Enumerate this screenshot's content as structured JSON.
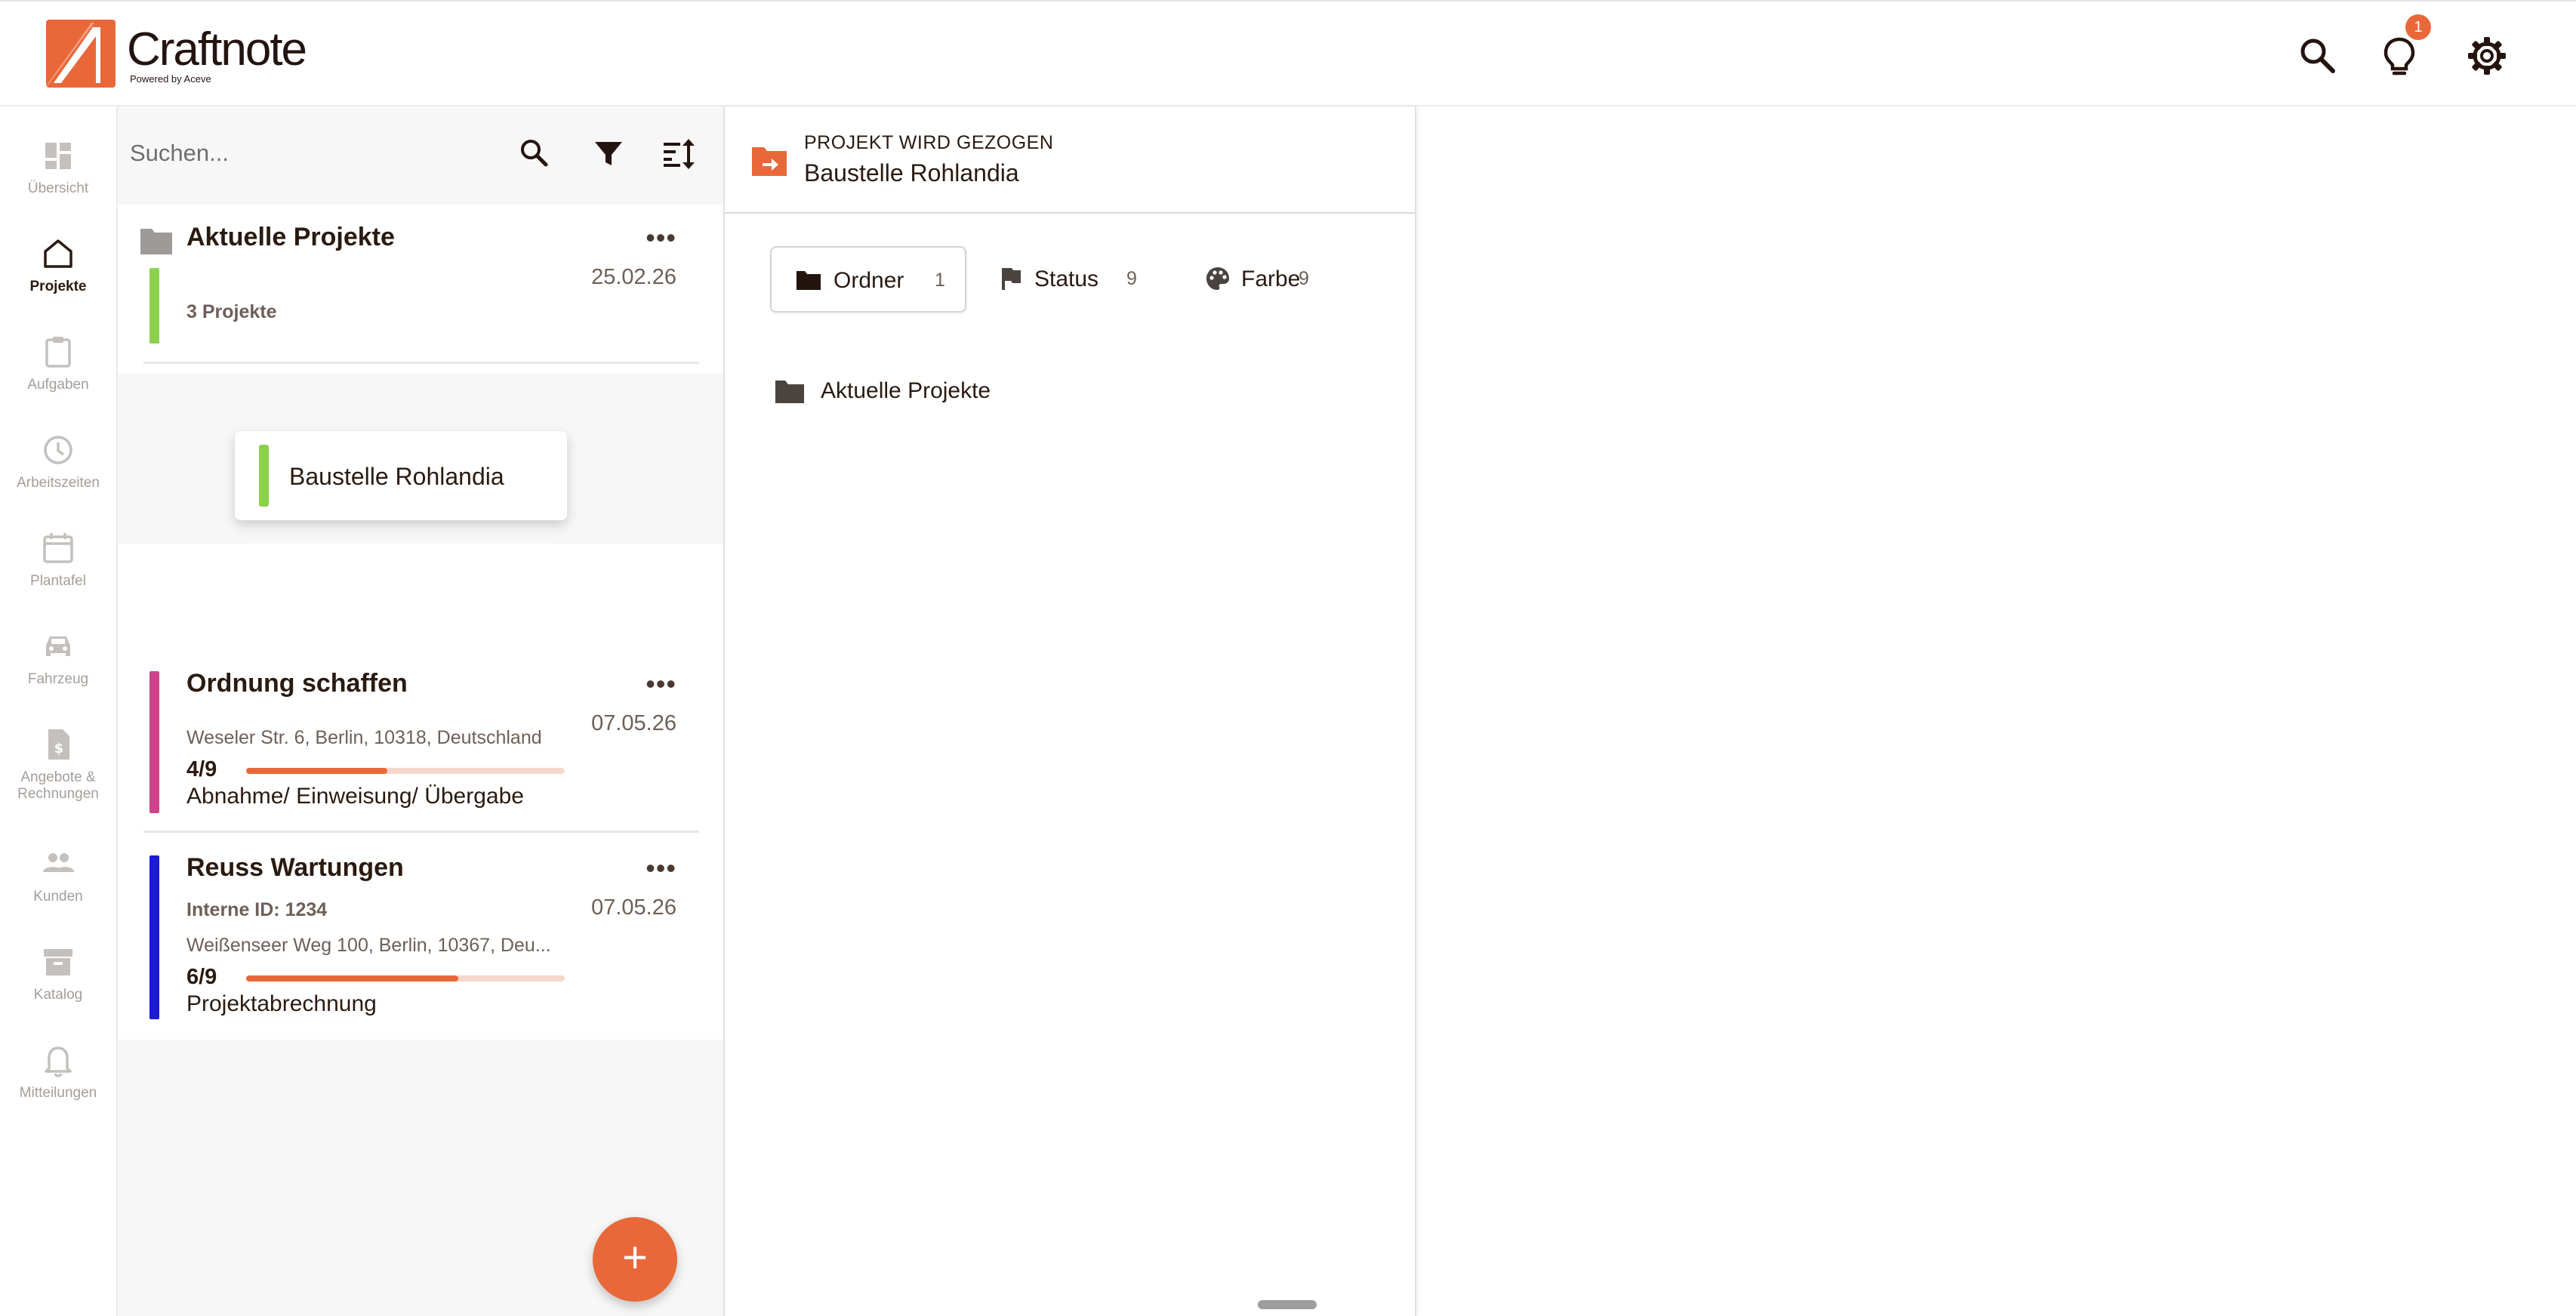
{
  "app": {
    "name": "Craftnote",
    "tagline": "Powered by Aceve",
    "notification_count": "1"
  },
  "nav": {
    "items": [
      {
        "label": "Übersicht"
      },
      {
        "label": "Projekte"
      },
      {
        "label": "Aufgaben"
      },
      {
        "label": "Arbeitszeiten"
      },
      {
        "label": "Plantafel"
      },
      {
        "label": "Fahrzeug"
      },
      {
        "label": "Angebote & Rechnungen"
      },
      {
        "label": "Kunden"
      },
      {
        "label": "Katalog"
      },
      {
        "label": "Mitteilungen"
      }
    ]
  },
  "search": {
    "placeholder": "Suchen..."
  },
  "folder_card": {
    "title": "Aktuelle Projekte",
    "date": "25.02.26",
    "count": "3 Projekte",
    "more": "•••"
  },
  "dragged": {
    "title": "Baustelle Rohlandia"
  },
  "projects": [
    {
      "title": "Ordnung schaffen",
      "date": "07.05.26",
      "address": "Weseler Str. 6, Berlin, 10318, Deutschland",
      "progress_text": "4/9",
      "progress": 0.444,
      "stage": "Abnahme/ Einweisung/ Übergabe",
      "color": "#d1428d",
      "more": "•••"
    },
    {
      "title": "Reuss Wartungen",
      "date": "07.05.26",
      "internal_id": "Interne ID: 1234",
      "address": "Weißenseer Weg 100, Berlin, 10367, Deu...",
      "progress_text": "6/9",
      "progress": 0.667,
      "stage": "Projektabrechnung",
      "color": "#1b1bd1",
      "more": "•••"
    }
  ],
  "fab": {
    "label": "+"
  },
  "move_panel": {
    "kicker": "PROJEKT WIRD GEZOGEN",
    "title": "Baustelle Rohlandia",
    "tabs": [
      {
        "label": "Ordner",
        "count": "1"
      },
      {
        "label": "Status",
        "count": "9"
      },
      {
        "label": "Farbe",
        "count": "9"
      }
    ],
    "folders": [
      {
        "label": "Aktuelle Projekte"
      }
    ]
  },
  "colors": {
    "accent": "#e8683a",
    "folder_bar": "#8cd14b"
  }
}
